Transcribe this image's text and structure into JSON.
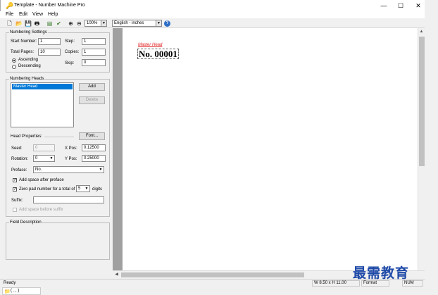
{
  "window": {
    "title": "Template - Number Machine Pro"
  },
  "menu": [
    "File",
    "Edit",
    "View",
    "Help"
  ],
  "toolbar": {
    "zoom": "100%",
    "units": "English - inches"
  },
  "numbering_settings": {
    "title": "Numbering Settings",
    "start_number_label": "Start Number:",
    "start_number": "1",
    "step_label": "Step:",
    "step": "1",
    "total_pages_label": "Total Pages:",
    "total_pages": "10",
    "copies_label": "Copies:",
    "copies": "1",
    "skip_label": "Skip:",
    "skip": "0",
    "ascending_label": "Ascending",
    "descending_label": "Descending",
    "order": "ascending"
  },
  "numbering_heads": {
    "title": "Numbering Heads",
    "items": [
      "Master Head"
    ],
    "add_label": "Add",
    "delete_label": "Delete"
  },
  "head_properties": {
    "title": "Head Properties:",
    "font_label": "Font...",
    "seed_label": "Seed:",
    "seed": "0",
    "xpos_label": "X Pos:",
    "xpos": "0.12500",
    "rotation_label": "Rotation:",
    "rotation": "0",
    "ypos_label": "Y Pos:",
    "ypos": "0.25000",
    "preface_label": "Preface:",
    "preface": "No.",
    "add_space_after_label": "Add space after preface",
    "zero_pad_label": "Zero pad number for a total of",
    "zero_pad_digits": "5",
    "digits_label": "digits",
    "suffix_label": "Suffix:",
    "suffix": "",
    "add_space_before_label": "Add space before suffix"
  },
  "field_description": {
    "title": "Field Description"
  },
  "preview": {
    "head_caption": "Master Head",
    "number_text": "No. 00001"
  },
  "status": {
    "left": "Ready",
    "size": "W 8.50 x H 11.00",
    "format": "Format",
    "num": "NUM"
  },
  "watermark": "最需教育",
  "taskbar": {
    "label": "( ... )"
  }
}
